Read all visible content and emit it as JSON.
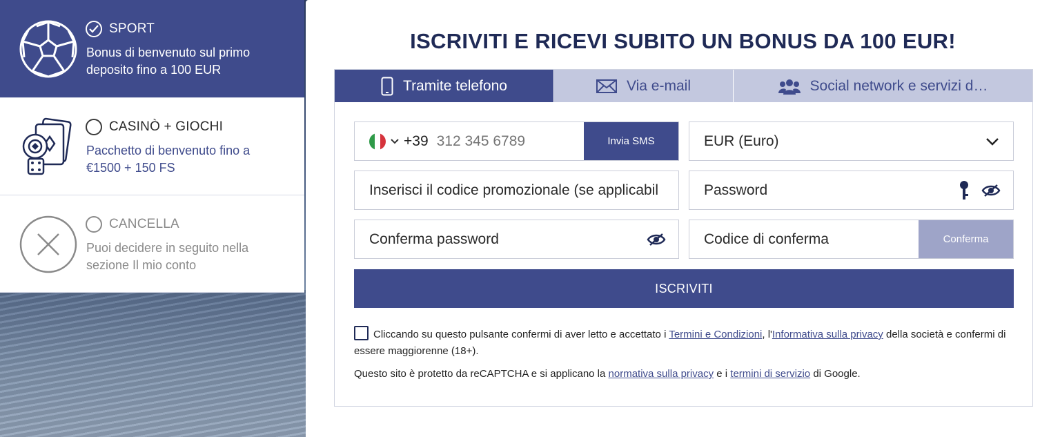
{
  "bonus_options": [
    {
      "title": "SPORT",
      "desc": "Bonus di benvenuto sul primo deposito fino a 100 EUR",
      "icon": "soccer-ball-icon",
      "selected": true
    },
    {
      "title": "CASINÒ + GIOCHI",
      "desc": "Pacchetto di benvenuto fino a €1500 + 150 FS",
      "icon": "casino-cards-icon",
      "selected": false
    },
    {
      "title": "CANCELLA",
      "desc": "Puoi decidere in seguito nella sezione Il mio conto",
      "icon": "cancel-x-icon",
      "selected": false
    }
  ],
  "heading": "ISCRIVITI E RICEVI SUBITO UN BONUS DA 100 EUR!",
  "tabs": [
    {
      "label": "Tramite telefono",
      "icon": "phone-icon",
      "active": true
    },
    {
      "label": "Via e-mail",
      "icon": "envelope-icon",
      "active": false
    },
    {
      "label": "Social network e servizi d…",
      "icon": "users-icon",
      "active": false
    }
  ],
  "form": {
    "phone_prefix": "+39",
    "phone_placeholder": "312 345 6789",
    "send_sms": "Invia SMS",
    "currency": "EUR (Euro)",
    "promo_placeholder": "Inserisci il codice promozionale (se applicabil",
    "password_placeholder": "Password",
    "confirm_password_placeholder": "Conferma password",
    "confirm_code_placeholder": "Codice di conferma",
    "confirm_button": "Conferma",
    "submit": "ISCRIVITI"
  },
  "terms": {
    "prefix": "Cliccando su questo pulsante confermi di aver letto e accettato i ",
    "link1": "Termini e Condizioni",
    "mid": ", l'",
    "link2": "Informativa sulla privacy",
    "suffix": " della società e confermi di essere maggiorenne (18+)."
  },
  "recaptcha": {
    "prefix": "Questo sito è protetto da reCAPTCHA e si applicano la ",
    "link1": "normativa sulla privacy",
    "mid": " e i ",
    "link2": "termini di servizio",
    "suffix": " di Google."
  },
  "colors": {
    "brand": "#3f4b8c",
    "tab_inactive": "#c3c8df",
    "confirm_disabled": "#9ea4c8"
  }
}
